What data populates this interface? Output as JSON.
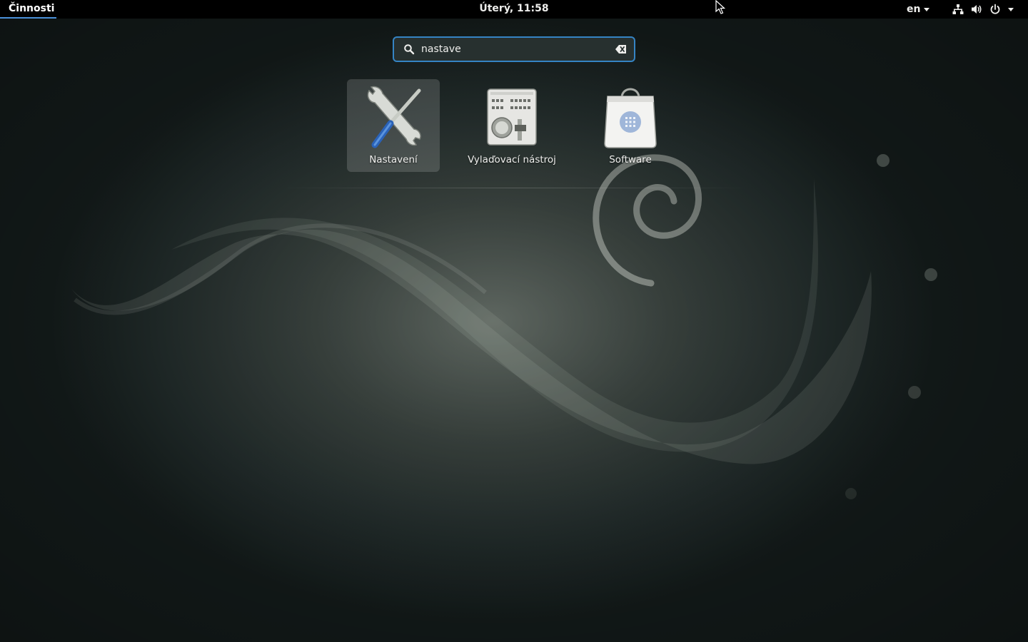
{
  "topbar": {
    "activities_label": "Činnosti",
    "clock": "Úterý, 11:58",
    "keyboard_layout": "en",
    "tray_icons": [
      "network-wired-icon",
      "volume-icon",
      "power-icon",
      "chevron-down-icon"
    ]
  },
  "search": {
    "value": "nastave",
    "icon": "search-icon",
    "clear_icon": "clear-text-icon"
  },
  "results": [
    {
      "label": "Nastavení",
      "icon": "settings-tools-icon",
      "selected": true
    },
    {
      "label": "Vylaďovací nástroj",
      "icon": "tweak-tool-icon",
      "selected": false
    },
    {
      "label": "Software",
      "icon": "software-bag-icon",
      "selected": false
    }
  ],
  "colors": {
    "accent": "#3584c4",
    "topbar": "#000000",
    "text": "#eeeeec"
  }
}
